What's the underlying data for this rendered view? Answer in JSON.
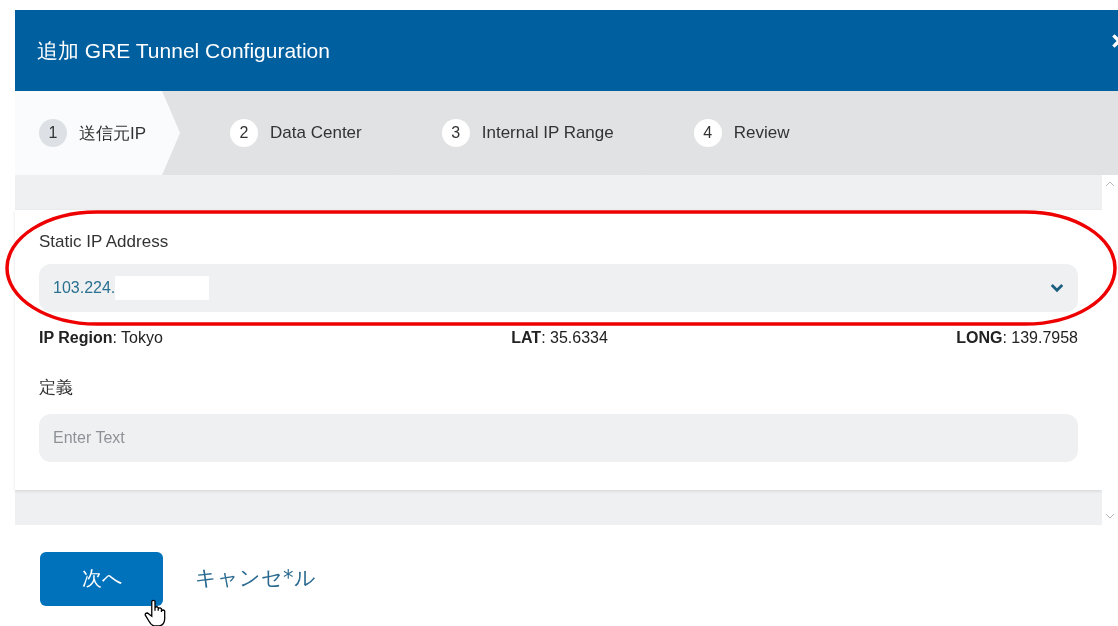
{
  "dialog": {
    "title": "追加 GRE Tunnel Configuration"
  },
  "steps": [
    {
      "number": "1",
      "label": "送信元IP",
      "selected": true
    },
    {
      "number": "2",
      "label": "Data Center",
      "selected": false
    },
    {
      "number": "3",
      "label": "Internal IP Range",
      "selected": false
    },
    {
      "number": "4",
      "label": "Review",
      "selected": false
    }
  ],
  "static_ip": {
    "label": "Static IP Address",
    "value": "103.224."
  },
  "location": [
    "**IP Region**: Tokyo",
    "**LAT**: 35.6334",
    "**LONG**: 139.7958"
  ],
  "definition": {
    "label": "定義",
    "placeholder": "Enter Text"
  },
  "buttons": {
    "next": "次へ",
    "cancel": "キャンセ*ル"
  }
}
